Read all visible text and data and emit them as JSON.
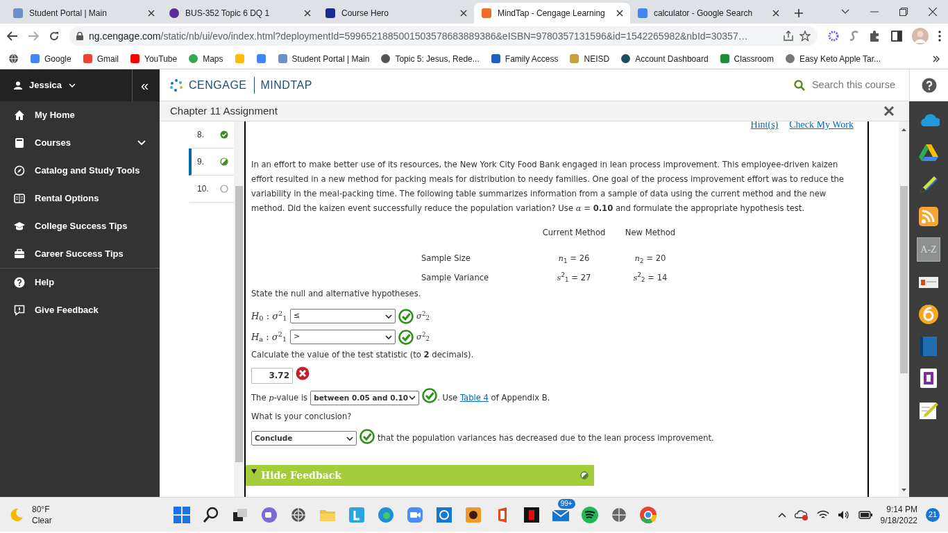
{
  "browser": {
    "tabs": [
      {
        "title": "Student Portal | Main",
        "selected": false
      },
      {
        "title": "BUS-352 Topic 6 DQ 1",
        "selected": false
      },
      {
        "title": "Course Hero",
        "selected": false
      },
      {
        "title": "MindTap - Cengage Learning",
        "selected": true
      },
      {
        "title": "calculator - Google Search",
        "selected": false
      }
    ],
    "url": {
      "host": "ng.cengage.com",
      "path": "/static/nb/ui/evo/index.html?deploymentId=5996521885001503578683889386&eISBN=9780357131596&id=1542265982&nbId=30357…"
    },
    "bookmarks": [
      {
        "kind": "link",
        "label": "Google"
      },
      {
        "kind": "link",
        "label": "Gmail"
      },
      {
        "kind": "link",
        "label": "YouTube"
      },
      {
        "kind": "link",
        "label": "Maps"
      },
      {
        "kind": "icon"
      },
      {
        "kind": "icon"
      },
      {
        "kind": "link",
        "label": "Student Portal | Main"
      },
      {
        "kind": "link",
        "label": "Topic 5: Jesus, Rede..."
      },
      {
        "kind": "link",
        "label": "Family Access"
      },
      {
        "kind": "link",
        "label": "NEISD"
      },
      {
        "kind": "link",
        "label": "Account Dashboard"
      },
      {
        "kind": "link",
        "label": "Classroom"
      },
      {
        "kind": "link",
        "label": "Easy Keto Apple Tar..."
      }
    ]
  },
  "sidebar": {
    "user": "Jessica",
    "collapse": "«",
    "items": [
      {
        "label": "My Home",
        "expandable": false
      },
      {
        "label": "Courses",
        "expandable": true
      },
      {
        "label": "Catalog and Study Tools",
        "expandable": false
      },
      {
        "label": "Rental Options",
        "expandable": false
      },
      {
        "label": "College Success Tips",
        "expandable": false
      },
      {
        "label": "Career Success Tips",
        "expandable": false
      },
      {
        "label": "Help",
        "expandable": false
      },
      {
        "label": "Give Feedback",
        "expandable": false
      }
    ]
  },
  "header": {
    "brand": "CENGAGE",
    "product": "MINDTAP",
    "search": "Search this course"
  },
  "assignment": {
    "title": "Chapter 11 Assignment",
    "questions": [
      {
        "number": "8.",
        "kind": "correct",
        "selected": false
      },
      {
        "number": "9.",
        "kind": "partial",
        "selected": true
      },
      {
        "number": "10.",
        "kind": "unanswered",
        "selected": false
      }
    ],
    "links": [
      "Hint(s)",
      "Check My Work"
    ],
    "problem": "In an effort to make better use of its resources, the New York City Food Bank engaged in lean process improvement. This employee-driven kaizen effort resulted in a new method for packing meals for distribution to needy families. One goal of the process improvement effort was to reduce the variability in the meal-packing time. The following table summarizes information from a sample of data using the current method and the new method. Did the kaizen event successfully reduce the population variation? Use *α* = **0.10** and formulate the appropriate hypothesis test.",
    "table": {
      "columns": [
        "Current Method",
        "New Method"
      ],
      "rows": [
        {
          "label": "Sample Size",
          "cells": [
            "*n*$_{1}$ = 26",
            "*n*$_{2}$ = 20"
          ]
        },
        {
          "label": "Sample Variance",
          "cells": [
            "*s*$^{2}$$_{1}$ = 27",
            "*s*$^{2}$$_{2}$ = 14"
          ]
        }
      ]
    },
    "hypotheses_prompt": "State the null and alternative hypotheses.",
    "hypotheses": [
      {
        "lhs": "*H*$_{0}$ : *σ*$^{2}$$_{1}$",
        "value": "≤",
        "correct": true,
        "rhs": "*σ*$^{2}$$_{2}$"
      },
      {
        "lhs": "*H*$_{a}$ : *σ*$^{2}$$_{1}$",
        "value": ">",
        "correct": true,
        "rhs": "*σ*$^{2}$$_{2}$"
      }
    ],
    "statistic_prompt": "Calculate the value of the test statistic (to **2** decimals).",
    "statistic": {
      "value": "3.72",
      "correct": false
    },
    "pvalue": {
      "before": "The *p*-value is",
      "value": "between 0.05 and 0.10",
      "correct": true,
      "after": ". Use ",
      "link": "Table 4",
      "tail": " of Appendix B."
    },
    "conclusion_prompt": "What is your conclusion?",
    "conclusion": {
      "value": "Conclude",
      "correct": true,
      "text": "that the population variances has decreased due to the lean process improvement."
    },
    "feedback": {
      "label": "Hide Feedback",
      "expanded": true
    }
  },
  "app_dock": {
    "label": "A-Z"
  },
  "taskbar": {
    "temperature": "80°F",
    "condition": "Clear",
    "mail_badge": "99+",
    "time": "9:14 PM",
    "date": "9/18/2022",
    "notifications": "21"
  }
}
